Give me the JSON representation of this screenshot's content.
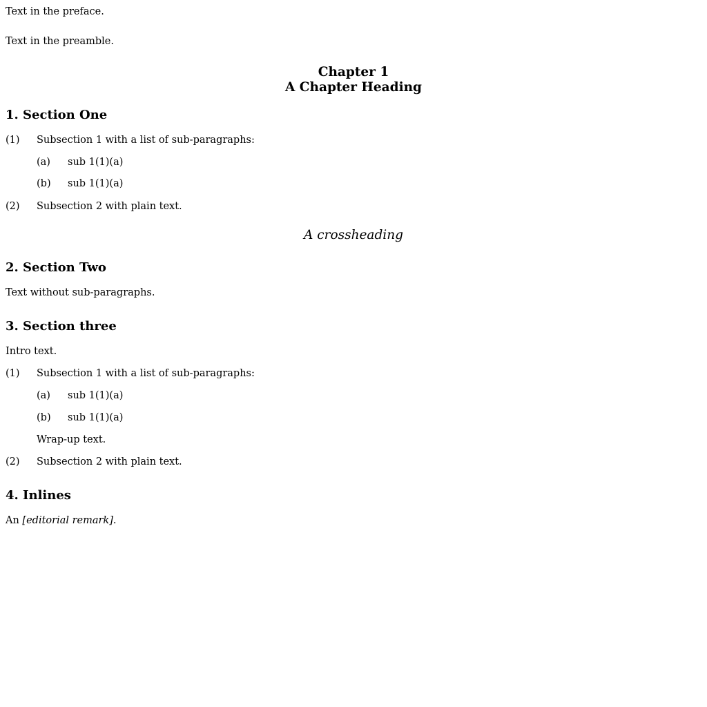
{
  "preface": "Text in the preface.",
  "preamble": "Text in the preamble.",
  "chapter": {
    "number": "Chapter 1",
    "title": "A Chapter Heading"
  },
  "section1": {
    "heading": "1. Section One",
    "sub1": {
      "num": "(1)",
      "text": "Subsection 1 with a list of sub-paragraphs:",
      "items": [
        {
          "num": "(a)",
          "text": "sub 1(1)(a)"
        },
        {
          "num": "(b)",
          "text": "sub 1(1)(a)"
        }
      ]
    },
    "sub2": {
      "num": "(2)",
      "text": "Subsection 2 with plain text."
    }
  },
  "crossheading": "A crossheading",
  "section2": {
    "heading": "2. Section Two",
    "text": "Text without sub-paragraphs."
  },
  "section3": {
    "heading": "3. Section three",
    "intro": "Intro text.",
    "sub1": {
      "num": "(1)",
      "text": "Subsection 1 with a list of sub-paragraphs:",
      "items": [
        {
          "num": "(a)",
          "text": "sub 1(1)(a)"
        },
        {
          "num": "(b)",
          "text": "sub 1(1)(a)"
        }
      ],
      "wrapup": "Wrap-up text."
    },
    "sub2": {
      "num": "(2)",
      "text": "Subsection 2 with plain text."
    }
  },
  "section4": {
    "heading": "4. Inlines",
    "text_prefix": "An ",
    "remark": "[editorial remark]",
    "text_suffix": "."
  }
}
